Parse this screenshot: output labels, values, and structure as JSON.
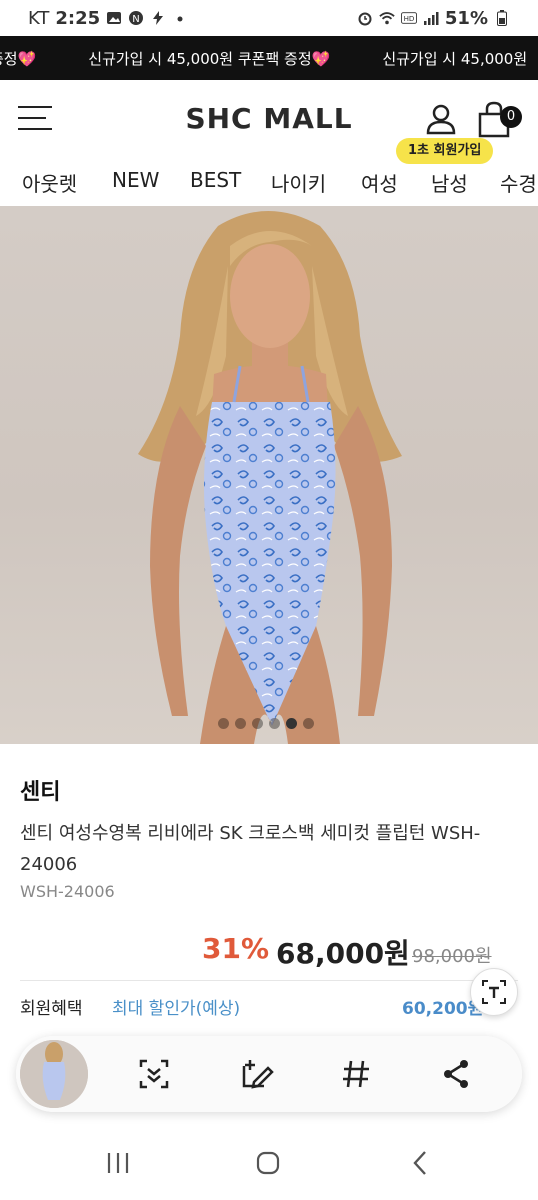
{
  "status_bar": {
    "carrier": "KT",
    "time": "2:25",
    "icons_left": [
      "gallery-icon",
      "n-icon",
      "flash-icon",
      "dot-icon"
    ],
    "icons_right": [
      "alarm-icon",
      "wifi-icon",
      "hd-icon",
      "signal-icon"
    ],
    "battery": "51%"
  },
  "promo_banner": {
    "text_partial": "증정💖",
    "text_1": "신규가입 시 45,000원 쿠폰팩 증정💖",
    "text_2": "신규가입 시 45,000원"
  },
  "header": {
    "logo": "SHC MALL",
    "cart_count": "0",
    "join_badge": "1초 회원가입"
  },
  "category_nav": {
    "items": [
      "아웃렛",
      "NEW",
      "BEST",
      "나이키",
      "여성",
      "남성",
      "수경"
    ]
  },
  "product": {
    "brand": "센티",
    "title": "센티 여성수영복 리비에라 SK 크로스백 세미컷 플립턴 WSH-24006",
    "code": "WSH-24006",
    "discount": "31%",
    "price": "68,000원",
    "original_price": "98,000원",
    "member_label": "회원혜택",
    "member_link": "최대 할인가(예상)",
    "member_price": "60,200원"
  },
  "image_carousel": {
    "total": 6,
    "active_index": 4
  },
  "float_button": {
    "label": "T"
  },
  "share_toolbar": {
    "tools": [
      "scan-icon",
      "edit-icon",
      "hashtag-icon",
      "share-icon"
    ]
  },
  "system_nav": {
    "items": [
      "recents-button",
      "home-button",
      "back-button"
    ]
  },
  "colors": {
    "discount": "#e05a3a",
    "member_link": "#4a90c8",
    "join_badge": "#f6e34a",
    "banner_bg": "#111111"
  }
}
